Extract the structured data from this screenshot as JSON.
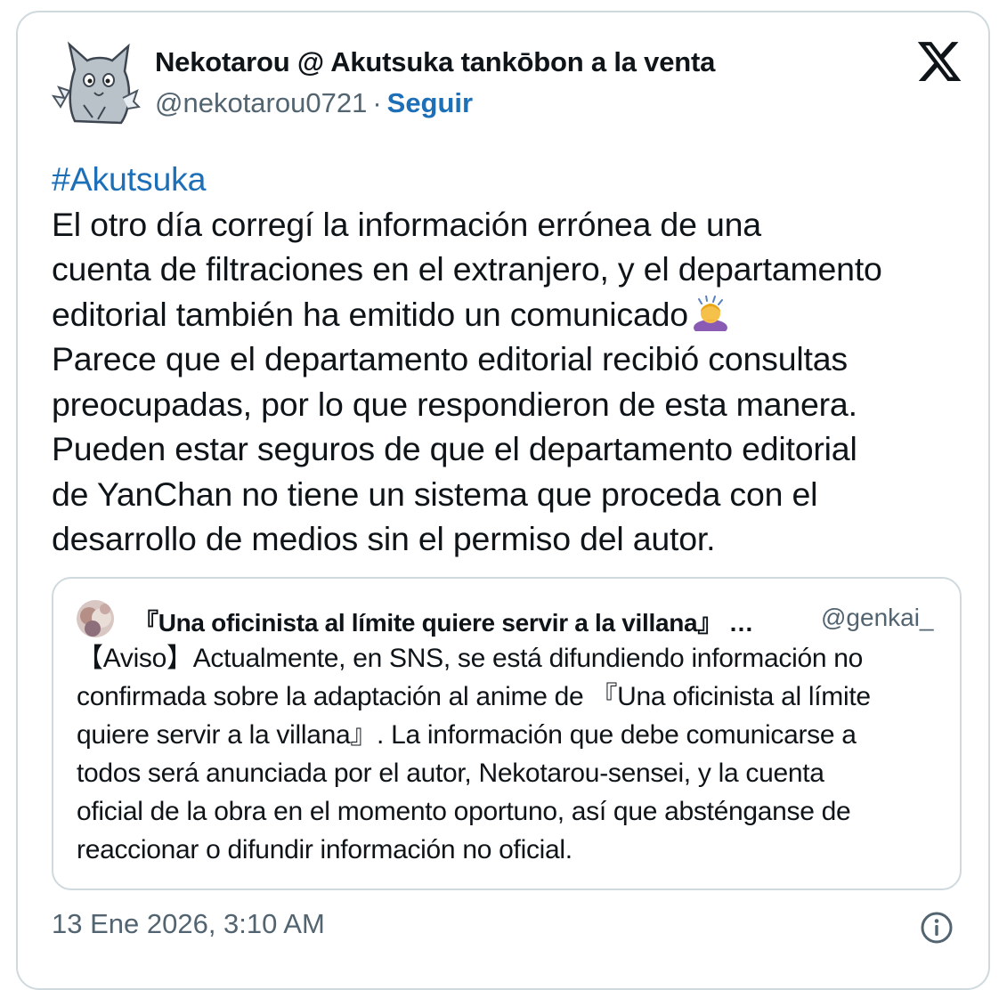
{
  "author": {
    "display_name": "Nekotarou @ Akutsuka tankōbon a la venta",
    "handle": "@nekotarou0721",
    "separator": "·",
    "follow_label": "Seguir"
  },
  "post": {
    "hashtag": "#Akutsuka",
    "lines": [
      "El otro día corregí la información errónea de una",
      "cuenta de filtraciones en el extranjero, y el departamento",
      "editorial también ha emitido un comunicado",
      "Parece que el departamento editorial recibió consultas",
      "preocupadas, por lo que respondieron de esta manera.",
      "Pueden estar seguros de que el departamento editorial",
      "de YanChan no tiene un sistema que proceda con el",
      "desarrollo de medios sin el permiso del autor."
    ]
  },
  "quote": {
    "display_name": "『Una oficinista al límite quiere servir a la villana』 …",
    "handle": "@genkai_",
    "lines": [
      "【Aviso】Actualmente, en SNS, se está difundiendo información no",
      "confirmada sobre la adaptación al anime de 『Una oficinista al límite",
      "quiere servir a la villana』. La información que debe comunicarse a",
      "todos será anunciada por el autor, Nekotarou-sensei, y la cuenta",
      "oficial de la obra en el momento oportuno, así que absténganse de",
      "reaccionar o difundir información no oficial."
    ]
  },
  "timestamp": "13 Ene 2026, 3:10 AM",
  "icons": {
    "avatar": "cat-avatar-icon",
    "platform": "x-logo-icon",
    "emoji": "person-bowing-emoji-icon",
    "info": "info-icon"
  },
  "colors": {
    "link": "#1d6fb8",
    "muted": "#536471",
    "border": "#cfd9de",
    "text": "#0f1419"
  }
}
